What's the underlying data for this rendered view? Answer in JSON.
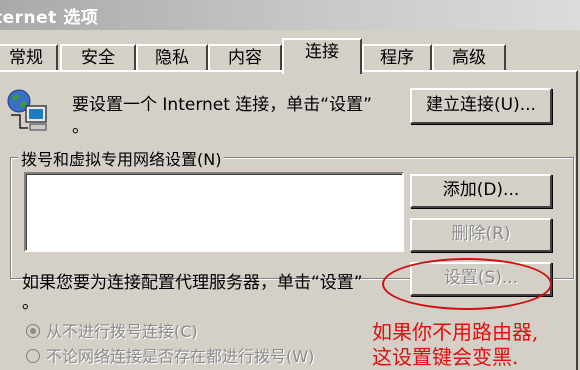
{
  "window": {
    "title": "ternet 选项"
  },
  "tabs": [
    "常规",
    "安全",
    "隐私",
    "内容",
    "连接",
    "程序",
    "高级"
  ],
  "active_tab_index": 4,
  "setup": {
    "text_line1": "要设置一个 Internet 连接，单击“设置”",
    "text_line2": "。",
    "button_label": "建立连接(U)..."
  },
  "dialup_group": {
    "title": "拨号和虚拟专用网络设置(N)",
    "add_label": "添加(D)...",
    "remove_label": "删除(R)",
    "settings_label": "设置(S)...",
    "proxy_text_line1": "如果您要为连接配置代理服务器，单击“设置”",
    "proxy_text_line2": "。"
  },
  "radios": [
    {
      "label": "从不进行拨号连接(C)",
      "selected": true
    },
    {
      "label": "不论网络连接是否存在都进行拨号(W)",
      "selected": false
    }
  ],
  "annotation": {
    "line1": "如果你不用路由器,",
    "line2": "这设置键会变黑.",
    "color": "#e01010"
  },
  "icon": {
    "name": "network-computer-icon"
  }
}
